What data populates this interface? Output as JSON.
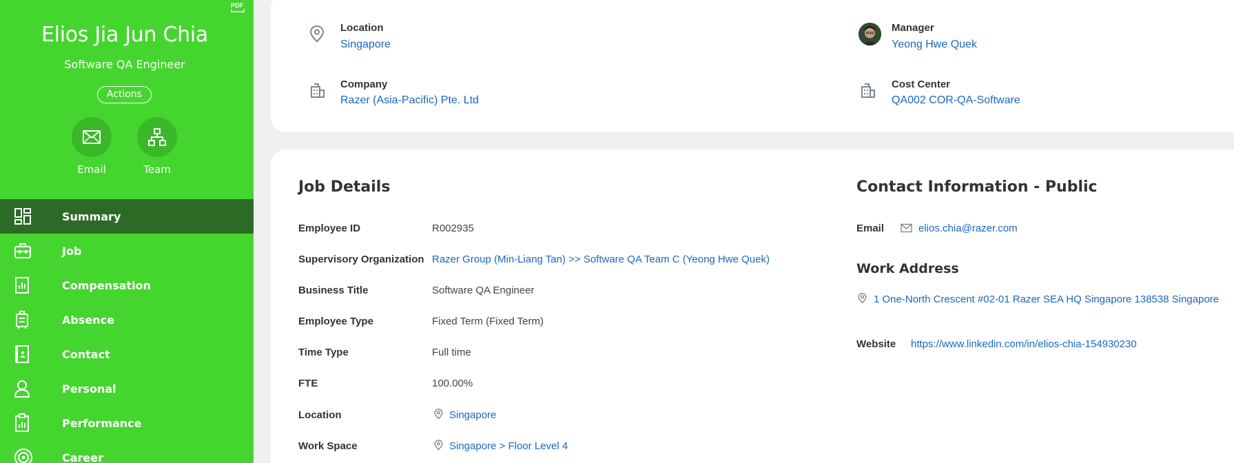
{
  "worker": {
    "name": "Elios Jia Jun Chia",
    "title": "Software QA Engineer",
    "actions_label": "Actions",
    "pdf_label": "PDF"
  },
  "quick_actions": [
    {
      "label": "Email",
      "icon": "envelope-icon"
    },
    {
      "label": "Team",
      "icon": "org-chart-icon"
    }
  ],
  "nav": [
    {
      "label": "Summary",
      "icon": "dashboard-icon",
      "active": true
    },
    {
      "label": "Job",
      "icon": "briefcase-icon",
      "active": false
    },
    {
      "label": "Compensation",
      "icon": "chart-icon",
      "active": false
    },
    {
      "label": "Absence",
      "icon": "luggage-icon",
      "active": false
    },
    {
      "label": "Contact",
      "icon": "contact-book-icon",
      "active": false
    },
    {
      "label": "Personal",
      "icon": "person-icon",
      "active": false
    },
    {
      "label": "Performance",
      "icon": "clipboard-chart-icon",
      "active": false
    },
    {
      "label": "Career",
      "icon": "target-icon",
      "active": false
    }
  ],
  "summary": {
    "location_label": "Location",
    "location_value": "Singapore",
    "manager_label": "Manager",
    "manager_value": "Yeong Hwe Quek",
    "company_label": "Company",
    "company_value": "Razer (Asia-Pacific) Pte. Ltd",
    "cost_center_label": "Cost Center",
    "cost_center_value": "QA002 COR-QA-Software"
  },
  "job_details": {
    "title": "Job Details",
    "fields": [
      {
        "label": "Employee ID",
        "value": "R002935"
      },
      {
        "label": "Supervisory Organization",
        "value": "Razer Group (Min-Liang Tan) >> Software QA Team C (Yeong Hwe Quek)"
      },
      {
        "label": "Business Title",
        "value": "Software QA Engineer"
      },
      {
        "label": "Employee Type",
        "value": "Fixed Term (Fixed Term)"
      },
      {
        "label": "Time Type",
        "value": "Full time"
      },
      {
        "label": "FTE",
        "value": "100.00%"
      },
      {
        "label": "Location",
        "value": "Singapore"
      },
      {
        "label": "Work Space",
        "value": "Singapore > Floor Level 4"
      }
    ]
  },
  "contact": {
    "title": "Contact Information - Public",
    "email_label": "Email",
    "email_value": "elios.chia@razer.com",
    "work_address_title": "Work Address",
    "address_value": "1 One-North Crescent #02-01 Razer SEA HQ Singapore 138538 Singapore",
    "website_label": "Website",
    "website_value": "https://www.linkedin.com/in/elios-chia-154930230"
  },
  "colors": {
    "sidebar": "#45d52f",
    "sidebar_active": "#2d6a26",
    "link": "#1a67c0"
  }
}
